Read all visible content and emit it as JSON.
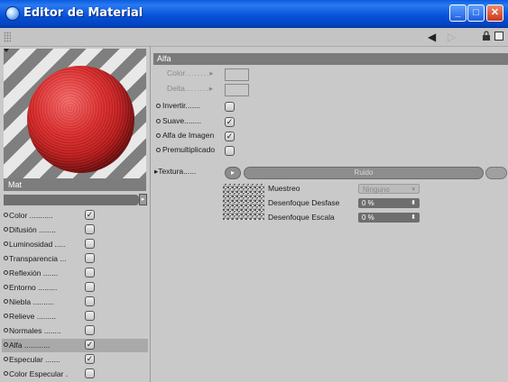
{
  "window": {
    "title": "Editor de Material"
  },
  "left": {
    "material_name": "Mat",
    "channels": [
      {
        "label": "Color",
        "checked": true
      },
      {
        "label": "Difusión",
        "checked": false
      },
      {
        "label": "Luminosidad",
        "checked": false
      },
      {
        "label": "Transparencia",
        "checked": false
      },
      {
        "label": "Reflexión",
        "checked": false
      },
      {
        "label": "Entorno",
        "checked": false
      },
      {
        "label": "Niebla",
        "checked": false
      },
      {
        "label": "Relieve",
        "checked": false
      },
      {
        "label": "Normales",
        "checked": false
      },
      {
        "label": "Alfa",
        "checked": true,
        "selected": true
      },
      {
        "label": "Especular",
        "checked": true
      },
      {
        "label": "Color Especular",
        "checked": false
      }
    ]
  },
  "right": {
    "section_title": "Alfa",
    "color_label": "Color",
    "delta_label": "Delta",
    "options": [
      {
        "label": "Invertir",
        "checked": false
      },
      {
        "label": "Suave",
        "checked": true
      },
      {
        "label": "Alfa de Imagen",
        "checked": true
      },
      {
        "label": "Premultiplicado",
        "checked": false
      }
    ],
    "texture_label": "Textura",
    "texture_name": "Ruido",
    "shader_params": [
      {
        "label": "Muestreo",
        "value": "Ninguno",
        "enabled": false
      },
      {
        "label": "Desenfoque Desfase",
        "value": "0 %",
        "enabled": true
      },
      {
        "label": "Desenfoque Escala",
        "value": "0 %",
        "enabled": true
      }
    ]
  },
  "icons": {
    "app": "material-sphere-icon",
    "back": "arrow-left-icon",
    "forward": "arrow-right-icon",
    "lock": "lock-icon",
    "new_window": "new-window-icon",
    "check": "✓"
  },
  "colors": {
    "titlebar": "#0a5be0",
    "sphere": "#d42020",
    "panel": "#c9c9c9",
    "section_header": "#7a7a7a"
  }
}
